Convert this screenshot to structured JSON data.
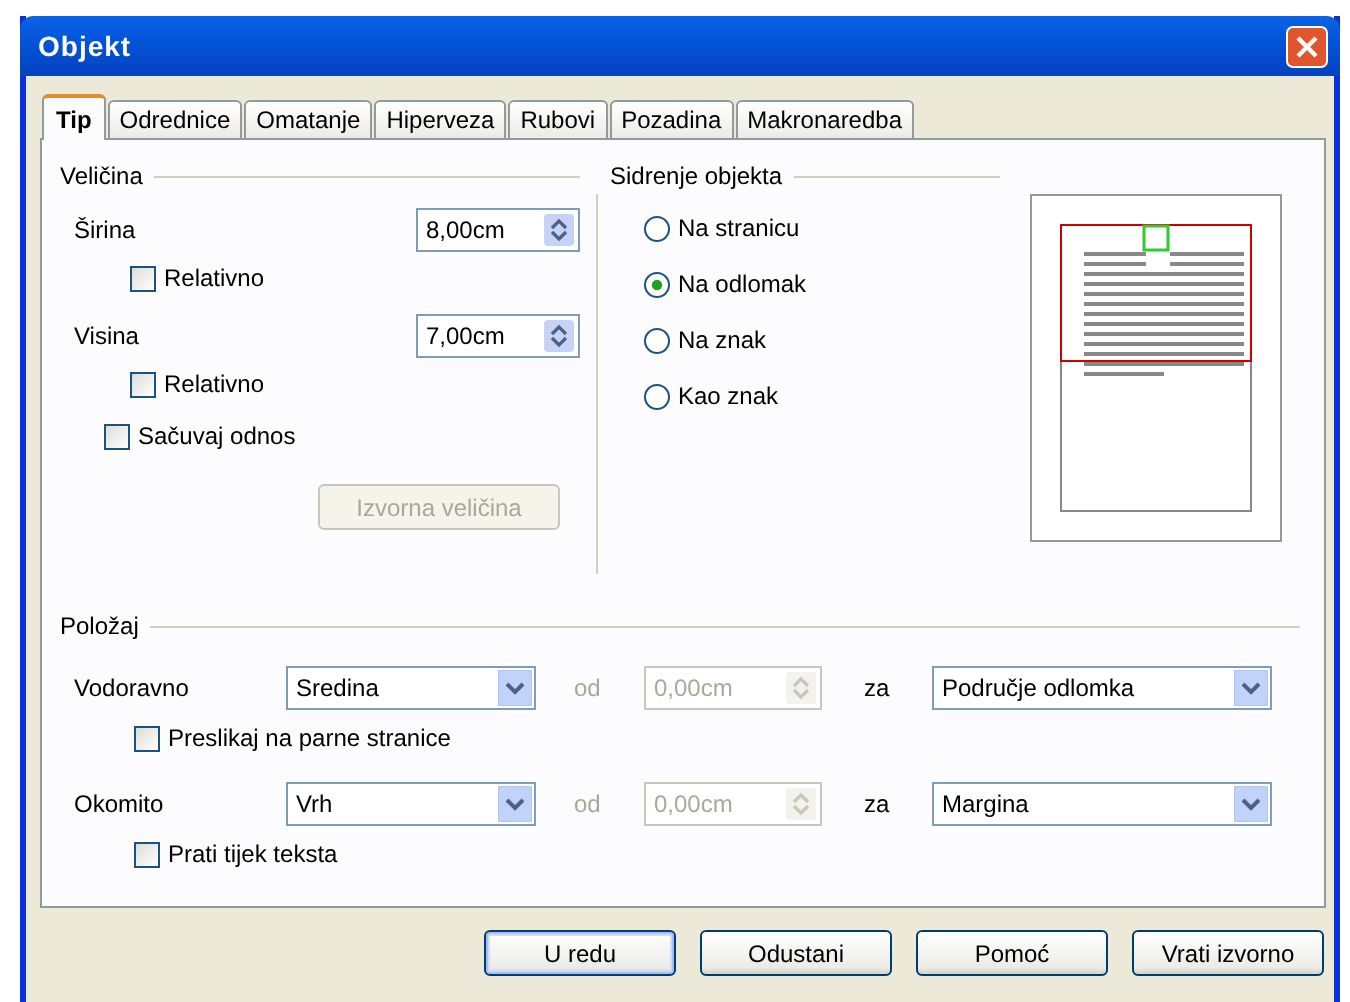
{
  "window": {
    "title": "Objekt"
  },
  "tabs": [
    {
      "label": "Tip",
      "selected": true
    },
    {
      "label": "Odrednice",
      "selected": false
    },
    {
      "label": "Omatanje",
      "selected": false
    },
    {
      "label": "Hiperveza",
      "selected": false
    },
    {
      "label": "Rubovi",
      "selected": false
    },
    {
      "label": "Pozadina",
      "selected": false
    },
    {
      "label": "Makronaredba",
      "selected": false
    }
  ],
  "size": {
    "title": "Veličina",
    "fields": [
      {
        "label": "Širina",
        "value": "8,00cm",
        "relative": {
          "label": "Relativno",
          "checked": false
        }
      },
      {
        "label": "Visina",
        "value": "7,00cm",
        "relative": {
          "label": "Relativno",
          "checked": false
        }
      }
    ],
    "keep_ratio": {
      "label": "Sačuvaj odnos",
      "checked": false
    },
    "original_size_button": {
      "label": "Izvorna veličina",
      "disabled": true
    }
  },
  "anchor": {
    "title": "Sidrenje objekta",
    "options": [
      {
        "label": "Na stranicu",
        "selected": false
      },
      {
        "label": "Na odlomak",
        "selected": true
      },
      {
        "label": "Na znak",
        "selected": false
      },
      {
        "label": "Kao znak",
        "selected": false
      }
    ]
  },
  "position": {
    "title": "Položaj",
    "rows": [
      {
        "label": "Vodoravno",
        "value": "Sredina",
        "from_label": "od",
        "offset": "0,00cm",
        "offset_disabled": true,
        "to_label": "za",
        "reference": "Područje odlomka",
        "option": {
          "label": "Preslikaj na parne stranice",
          "checked": false
        }
      },
      {
        "label": "Okomito",
        "value": "Vrh",
        "from_label": "od",
        "offset": "0,00cm",
        "offset_disabled": true,
        "to_label": "za",
        "reference": "Margina",
        "option": {
          "label": "Prati tijek teksta",
          "checked": false
        }
      }
    ]
  },
  "buttons": [
    {
      "label": "U redu",
      "default": true
    },
    {
      "label": "Odustani",
      "default": false
    },
    {
      "label": "Pomoć",
      "default": false
    },
    {
      "label": "Vrati izvorno",
      "default": false
    }
  ]
}
